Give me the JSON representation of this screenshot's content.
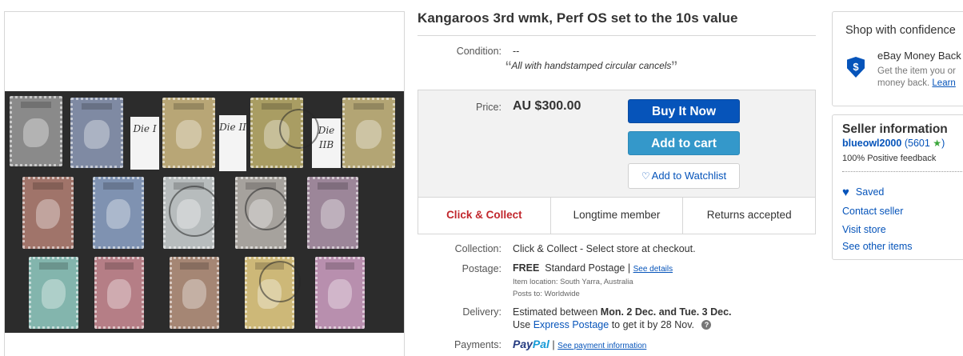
{
  "item": {
    "title": "Kangaroos 3rd wmk, Perf OS set to the 10s value"
  },
  "image": {
    "notes": [
      "Die I",
      "Die II",
      "Die IIB"
    ],
    "stamp_colors": [
      "#8a8a8a",
      "#7f8aa3",
      "#b8a676",
      "#a99d63",
      "#b3a574",
      "#a0746a",
      "#7f92b1",
      "#b7bcbd",
      "#a6a29d",
      "#9c8699",
      "#83b5ad",
      "#b57e86",
      "#a58674",
      "#cdb878",
      "#b88fae"
    ]
  },
  "condition": {
    "label": "Condition:",
    "value": "--",
    "quote_open": "“",
    "quote_text": "All with handstamped circular cancels",
    "quote_close": "”"
  },
  "price": {
    "label": "Price:",
    "value": "AU $300.00"
  },
  "buttons": {
    "buy_now": "Buy It Now",
    "add_to_cart": "Add to cart",
    "watchlist": "Add to Watchlist"
  },
  "features": [
    "Click & Collect",
    "Longtime member",
    "Returns accepted"
  ],
  "collection": {
    "label": "Collection:",
    "value": "Click & Collect - Select store at checkout."
  },
  "postage": {
    "label": "Postage:",
    "free": "FREE",
    "service": "Standard Postage",
    "separator": "|",
    "details_link": "See details",
    "location": "Item location:  South Yarra, Australia",
    "posts_to": "Posts to:  Worldwide"
  },
  "delivery": {
    "label": "Delivery:",
    "prefix": "Estimated between",
    "date_range": "Mon. 2 Dec. and Tue. 3 Dec.",
    "use": "Use",
    "express_link": "Express Postage",
    "suffix": "to get it by 28 Nov.",
    "help_glyph": "?"
  },
  "payments": {
    "label": "Payments:",
    "paypal_a": "Pay",
    "paypal_b": "Pal",
    "separator": "|",
    "link": "See payment information"
  },
  "confidence": {
    "title": "Shop with confidence",
    "shield_glyph": "$",
    "subtitle": "eBay Money Back",
    "line1": "Get the item you or",
    "line2_text": "money back.",
    "line2_link": "Learn"
  },
  "seller": {
    "title": "Seller information",
    "username": "blueowl2000",
    "score": "(5601",
    "star": "★",
    "score_close": ")",
    "feedback": "100% Positive feedback",
    "saved": "Saved",
    "contact": "Contact seller",
    "visit": "Visit store",
    "other": "See other items"
  },
  "colors": {
    "link": "#0654ba",
    "buy_now": "#0654ba",
    "add_to_cart": "#3498ca",
    "click_collect": "#c1272d"
  }
}
